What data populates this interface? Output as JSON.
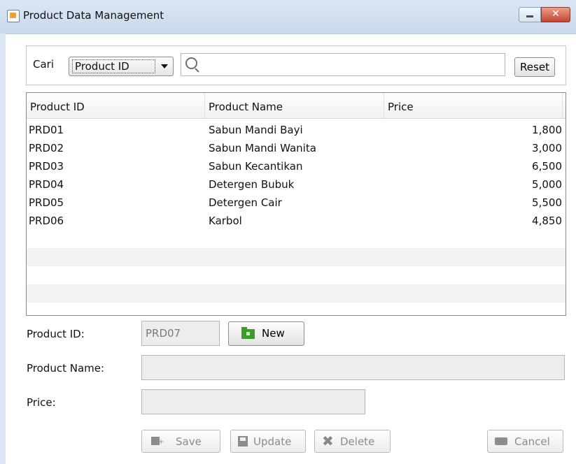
{
  "window": {
    "title": "Product Data Management",
    "close_glyph": "✕",
    "icons": [
      "app-icon",
      "minimize-icon",
      "close-icon"
    ]
  },
  "search": {
    "label": "Cari",
    "filter_selected": "Product ID",
    "query": "",
    "reset_label": "Reset"
  },
  "table": {
    "columns": [
      "Product ID",
      "Product Name",
      "Price"
    ],
    "rows": [
      {
        "id": "PRD01",
        "name": "Sabun Mandi Bayi",
        "price": "1,800"
      },
      {
        "id": "PRD02",
        "name": "Sabun Mandi Wanita",
        "price": "3,000"
      },
      {
        "id": "PRD03",
        "name": "Sabun Kecantikan",
        "price": "6,500"
      },
      {
        "id": "PRD04",
        "name": "Detergen Bubuk",
        "price": "5,000"
      },
      {
        "id": "PRD05",
        "name": "Detergen Cair",
        "price": "5,500"
      },
      {
        "id": "PRD06",
        "name": "Karbol",
        "price": "4,850"
      }
    ]
  },
  "form": {
    "product_id_label": "Product ID:",
    "product_id_value": "PRD07",
    "new_label": "New",
    "product_name_label": "Product Name:",
    "product_name_value": "",
    "price_label": "Price:",
    "price_value": ""
  },
  "actions": {
    "save": "Save",
    "update": "Update",
    "delete": "Delete",
    "cancel": "Cancel",
    "delete_glyph": "✖"
  },
  "colors": {
    "accent_green": "#3d9a2e",
    "close_red": "#c7452f",
    "disabled_text": "#8c8c8c"
  }
}
